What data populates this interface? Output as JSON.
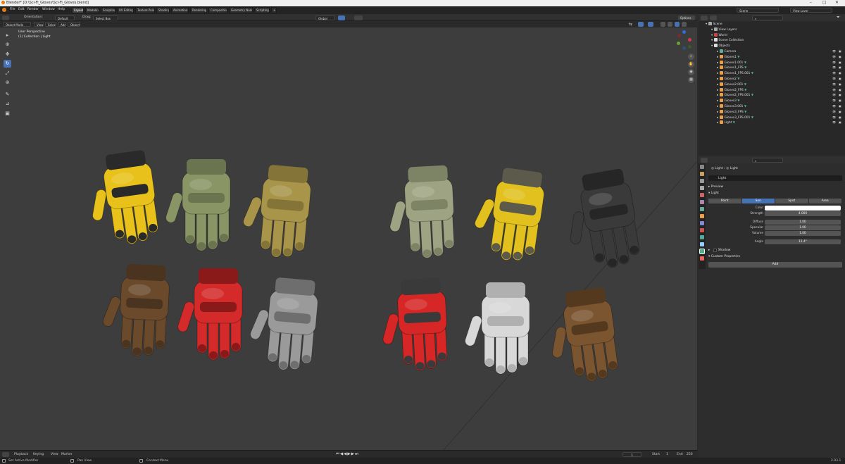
{
  "window": {
    "title": "Blender* [D:\\Sci-Fi_Gloves\\Sci-Fi_Gloves.blend]"
  },
  "menu": [
    "File",
    "Edit",
    "Render",
    "Window",
    "Help"
  ],
  "workspaces": [
    "Layout",
    "Modeling",
    "Sculpting",
    "UV Editing",
    "Texture Paint",
    "Shading",
    "Animation",
    "Rendering",
    "Compositing",
    "Geometry Nodes",
    "Scripting"
  ],
  "viewport_header": {
    "orientation_label": "Orientation:",
    "orientation_value": "Default",
    "drag_label": "Drag:",
    "drag_value": "Select Box",
    "pivot_value": "Global",
    "options": "Options"
  },
  "viewport_header2": {
    "mode": "Object Mode",
    "menus": [
      "View",
      "Select",
      "Add",
      "Object"
    ]
  },
  "overlay": {
    "perspective": "User Perspective",
    "collection": "(1) Collection | Light"
  },
  "gizmo": {
    "x": "X",
    "y": "Y",
    "z": "Z"
  },
  "timeline": {
    "menus": [
      "Playback",
      "Keying",
      "View",
      "Marker"
    ],
    "current_frame": "1",
    "start_label": "Start",
    "start": "1",
    "end_label": "End",
    "end": "250"
  },
  "statusbar": {
    "left": "Set Active Modifier",
    "middle": "Pan View",
    "right_hint": "Context Menu",
    "version": "2.93.1"
  },
  "outliner": {
    "scene": "Scene",
    "view_layer": "View Layer",
    "rows": [
      {
        "label": "Scene",
        "depth": 0,
        "kind": "scene"
      },
      {
        "label": "View Layers",
        "depth": 1,
        "kind": "layers"
      },
      {
        "label": "World",
        "depth": 1,
        "kind": "world"
      },
      {
        "label": "Scene Collection",
        "depth": 1,
        "kind": "collection"
      },
      {
        "label": "Objects",
        "depth": 1,
        "kind": "collection"
      },
      {
        "label": "Camera",
        "depth": 2,
        "kind": "camera"
      },
      {
        "label": "Gloves1",
        "depth": 2,
        "kind": "mesh"
      },
      {
        "label": "Gloves1.001",
        "depth": 2,
        "kind": "mesh"
      },
      {
        "label": "Gloves1_FPS",
        "depth": 2,
        "kind": "mesh"
      },
      {
        "label": "Gloves1_FPS.001",
        "depth": 2,
        "kind": "mesh"
      },
      {
        "label": "Gloves2",
        "depth": 2,
        "kind": "mesh"
      },
      {
        "label": "Gloves2.001",
        "depth": 2,
        "kind": "mesh"
      },
      {
        "label": "Gloves2_FPS",
        "depth": 2,
        "kind": "mesh"
      },
      {
        "label": "Gloves2_FPS.001",
        "depth": 2,
        "kind": "mesh"
      },
      {
        "label": "Gloves3",
        "depth": 2,
        "kind": "mesh"
      },
      {
        "label": "Gloves3.001",
        "depth": 2,
        "kind": "mesh"
      },
      {
        "label": "Gloves3_FPS",
        "depth": 2,
        "kind": "mesh"
      },
      {
        "label": "Gloves3_FPS.001",
        "depth": 2,
        "kind": "mesh"
      },
      {
        "label": "Light",
        "depth": 2,
        "kind": "light"
      }
    ]
  },
  "properties": {
    "breadcrumb_a": "Light",
    "breadcrumb_b": "Light",
    "datablock": "Light",
    "preview": "Preview",
    "light": "Light",
    "types": [
      "Point",
      "Sun",
      "Spot",
      "Area"
    ],
    "active_type": "Sun",
    "fields": [
      {
        "label": "Color",
        "value": ""
      },
      {
        "label": "Strength",
        "value": "4.000"
      },
      {
        "label": "Diffuse",
        "value": "1.00"
      },
      {
        "label": "Specular",
        "value": "1.00"
      },
      {
        "label": "Volume",
        "value": "1.00"
      },
      {
        "label": "Angle",
        "value": "11.4°"
      }
    ],
    "shadow": "Shadow",
    "custom_props": "Custom Properties",
    "add": "Add"
  },
  "gloves": [
    {
      "name": "glove-yellow-black-tactical",
      "main": "#e8c21a",
      "accent": "#2a2a2a"
    },
    {
      "name": "glove-olive-green",
      "main": "#8a9566",
      "accent": "#6a7550"
    },
    {
      "name": "glove-khaki",
      "main": "#a8954a",
      "accent": "#857437"
    },
    {
      "name": "glove-olive-fps",
      "main": "#9ea483",
      "accent": "#7d8365"
    },
    {
      "name": "glove-yellow-fps",
      "main": "#e2c11f",
      "accent": "#5c5a4a"
    },
    {
      "name": "glove-black-fps",
      "main": "#3a3a3a",
      "accent": "#262626"
    },
    {
      "name": "glove-brown-leather",
      "main": "#6b4a2c",
      "accent": "#4a331f"
    },
    {
      "name": "glove-red-tactical",
      "main": "#d42a2a",
      "accent": "#8a1a1a"
    },
    {
      "name": "glove-grey",
      "main": "#9a9a9a",
      "accent": "#6e6e6e"
    },
    {
      "name": "glove-red-fps",
      "main": "#d62626",
      "accent": "#3a3a3a"
    },
    {
      "name": "glove-white-fps",
      "main": "#d8d8d8",
      "accent": "#b0b0b0"
    },
    {
      "name": "glove-brown-fps",
      "main": "#7a5530",
      "accent": "#55391e"
    }
  ]
}
